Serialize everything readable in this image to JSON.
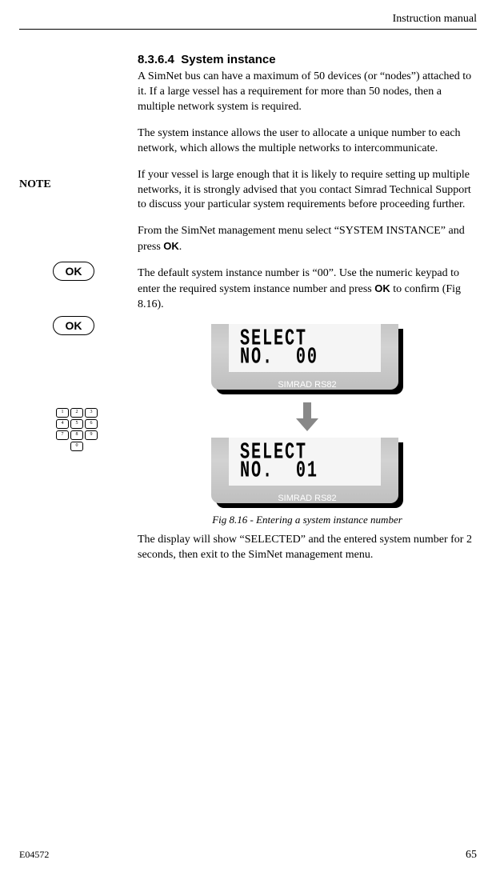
{
  "header": {
    "title": "Instruction manual"
  },
  "sidebar": {
    "note": "NOTE",
    "ok": "OK",
    "keypad": {
      "keys": [
        "1",
        "2",
        "3",
        "4",
        "5",
        "6",
        "7",
        "8",
        "9",
        "0"
      ]
    }
  },
  "section": {
    "number": "8.3.6.4",
    "title": "System instance",
    "p1": "A SimNet bus can have a maximum of 50 devices (or “nodes”) attached to it. If a large vessel has a requirement for more than 50 nodes, then a multiple network system is required.",
    "p2": "The system instance allows the user to allocate a unique number to each network, which allows the multiple networks to intercommunicate.",
    "p3": "If your vessel is large enough that it is likely to require setting up multiple networks, it is strongly advised that you contact Simrad Technical Support to discuss your particular system requirements before proceeding further.",
    "p4a": "From the SimNet management menu select “SYSTEM INSTANCE” and press ",
    "p4b": ".",
    "ok_label": "OK",
    "p5a": "The default system instance number is “00”. Use the numeric keypad to enter the required system instance number and press ",
    "p5b": " to conﬁrm (Fig 8.16).",
    "p6": "The display will show “SELECTED” and the entered system number for 2 seconds, then exit to the SimNet management menu."
  },
  "figure": {
    "screen1_line1": "SELECT",
    "screen1_line2": "NO.  00",
    "screen2_line1": "SELECT",
    "screen2_line2": "NO.  01",
    "model": "SIMRAD RS82",
    "caption": "Fig 8.16 - Entering a system instance number"
  },
  "footer": {
    "docnum": "E04572",
    "page": "65"
  }
}
